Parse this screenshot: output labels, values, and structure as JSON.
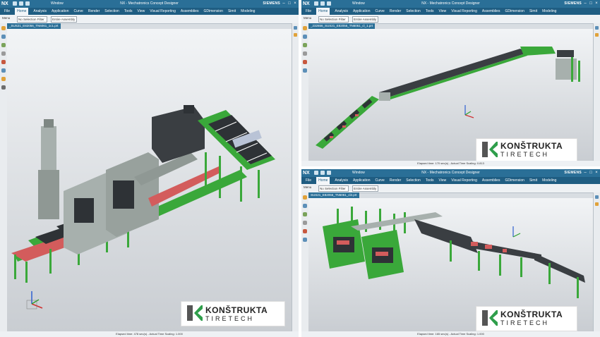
{
  "windows": {
    "left": {
      "logo_text": "NX",
      "title": "NX - Mechatronics Concept Designer",
      "brand": "SIEMENS",
      "menu_label": "Window",
      "menus": [
        "File",
        "Home",
        "Analysis",
        "Application",
        "Curve",
        "Render",
        "Selection",
        "Tools",
        "View",
        "Visual Reporting",
        "Assemblies",
        "GDimension",
        "Simit",
        "Modeling"
      ],
      "toolbar": {
        "menu": "Menu",
        "filter": "No Selection Filter",
        "scope": "Entire Assembly"
      },
      "tab": "_SUS21_E82056_TN6061_1c1.prt",
      "status": "Elapsed time: 478 sec(s) - Actual Time Scaling: 1.000",
      "company": "KONŠTRUKTA",
      "division": "TIRETECH"
    },
    "top_right": {
      "logo_text": "NX",
      "title": "NX - Mechatronics Concept Designer",
      "brand": "SIEMENS",
      "menu_label": "Window",
      "menus": [
        "File",
        "Home",
        "Analysis",
        "Application",
        "Curve",
        "Render",
        "Selection",
        "Tools",
        "View",
        "Visual Reporting",
        "Assemblies",
        "GDimension",
        "Simit",
        "Modeling"
      ],
      "toolbar": {
        "menu": "Menu",
        "filter": "No Selection Filter",
        "scope": "Entire Assembly"
      },
      "tab": "_232656_SUS21_E82056_TN6061_cl_1.prt",
      "status": "Elapsed time: 170 sec(s) - Actual Time Scaling: 0.813",
      "company": "KONŠTRUKTA",
      "division": "TIRETECH"
    },
    "bottom_right": {
      "logo_text": "NX",
      "title": "NX - Mechatronics Concept Designer",
      "brand": "SIEMENS",
      "menu_label": "Window",
      "menus": [
        "File",
        "Home",
        "Analysis",
        "Application",
        "Curve",
        "Render",
        "Selection",
        "Tools",
        "View",
        "Visual Reporting",
        "Assemblies",
        "GDimension",
        "Simit",
        "Modeling"
      ],
      "toolbar": {
        "menu": "Menu",
        "filter": "No Selection Filter",
        "scope": "Entire Assembly"
      },
      "tab": "SUS21_E82056_TN6061_cl2.prt",
      "status": "Elapsed time: 165 sec(s) - Actual Time Scaling: 1.000",
      "company": "KONŠTRUKTA",
      "division": "TIRETECH"
    }
  },
  "colors": {
    "titlebar": "#2a6f97",
    "frame_green": "#3aa83a",
    "conveyor_dark": "#2e3236",
    "belt_red": "#d35c5c",
    "machine_grey": "#a7b0ad",
    "brand_green": "#2f9e4b",
    "brand_grey": "#555555"
  }
}
